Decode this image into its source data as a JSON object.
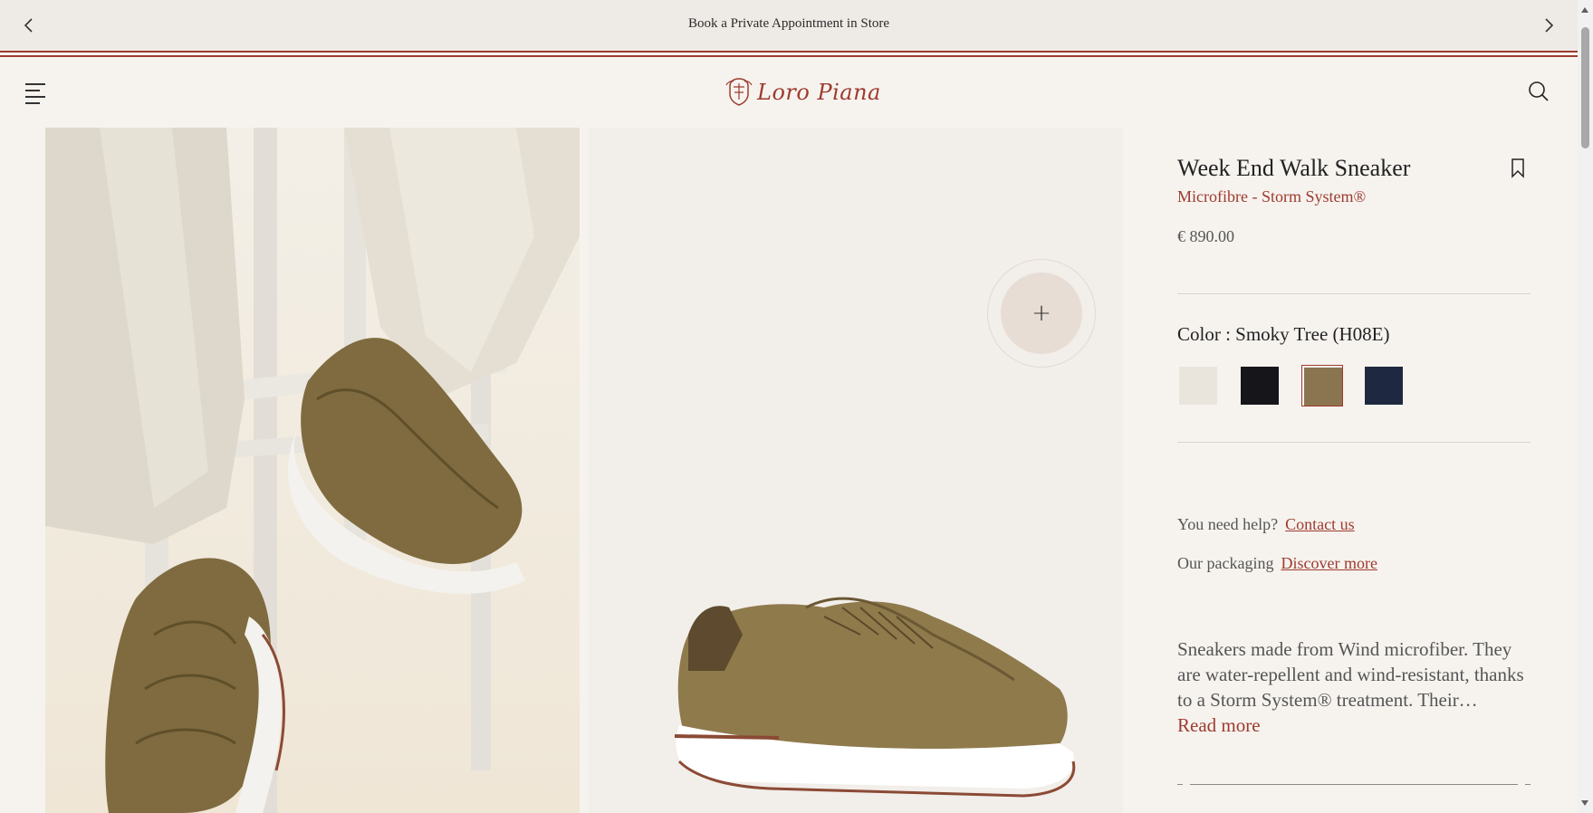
{
  "announcement": {
    "text": "Book a Private Appointment in Store",
    "prev_icon": "chevron-left-icon",
    "next_icon": "chevron-right-icon"
  },
  "header": {
    "menu_icon": "hamburger-menu-icon",
    "logo_text": "Loro Piana",
    "search_icon": "search-icon"
  },
  "gallery": {
    "images": [
      {
        "alt": "Model wearing sneakers seated on white chair"
      },
      {
        "alt": "Side view of sneaker"
      }
    ],
    "zoom_icon": "plus-icon"
  },
  "product": {
    "name": "Week End Walk Sneaker",
    "material": "Microfibre - Storm System®",
    "price": "€ 890.00",
    "wishlist_icon": "bookmark-icon",
    "color_label": "Color : Smoky Tree (H08E)",
    "swatches": [
      {
        "color": "#e9e5dc",
        "selected": false
      },
      {
        "color": "#16161a",
        "selected": false
      },
      {
        "color": "#8a7550",
        "selected": true
      },
      {
        "color": "#1e2840",
        "selected": false
      }
    ],
    "help_text": "You need help?",
    "help_link": "Contact us",
    "packaging_text": "Our packaging",
    "packaging_link": "Discover more",
    "description": "Sneakers made from Wind microfiber. They are water-repellent and wind-resistant, thanks to a Storm System® treatment. Their…",
    "read_more": "Read more"
  },
  "colors": {
    "accent": "#9e3a2e",
    "background": "#f6f3ef"
  }
}
